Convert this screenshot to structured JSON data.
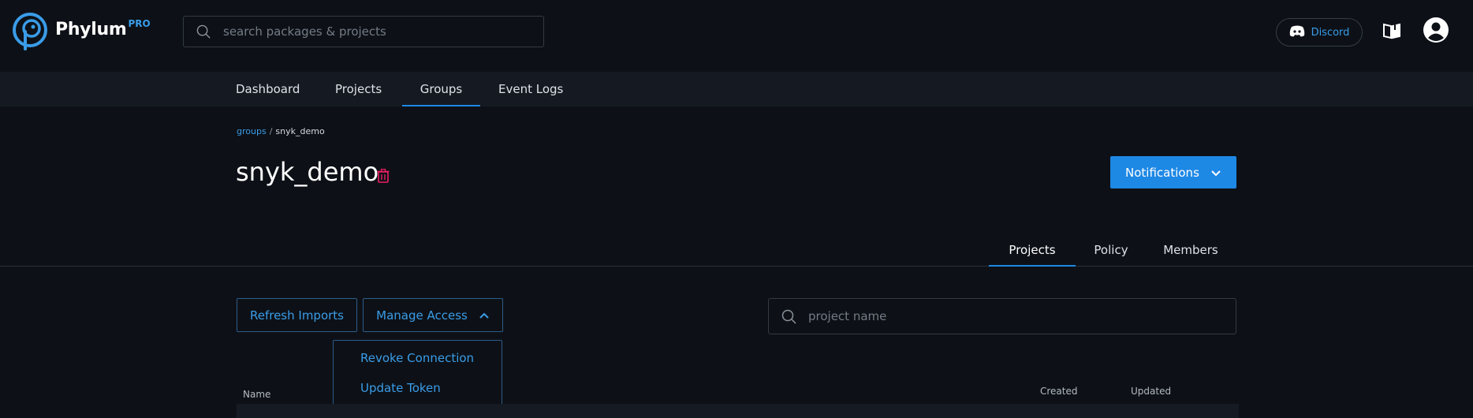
{
  "brand": {
    "name": "Phylum",
    "badge": "PRO"
  },
  "search": {
    "placeholder": "search packages & projects"
  },
  "header": {
    "discord_label": "Discord"
  },
  "nav": [
    {
      "label": "Dashboard"
    },
    {
      "label": "Projects"
    },
    {
      "label": "Groups",
      "active": true
    },
    {
      "label": "Event Logs"
    }
  ],
  "breadcrumb": {
    "parent": "groups",
    "separator": "/",
    "current": "snyk_demo"
  },
  "page": {
    "title": "snyk_demo",
    "notifications_label": "Notifications"
  },
  "tabs": [
    {
      "label": "Projects",
      "active": true
    },
    {
      "label": "Policy"
    },
    {
      "label": "Members"
    }
  ],
  "actions": {
    "refresh_label": "Refresh Imports",
    "manage_label": "Manage Access"
  },
  "manage_menu": [
    {
      "label": "Revoke Connection"
    },
    {
      "label": "Update Token"
    }
  ],
  "project_search": {
    "placeholder": "project name"
  },
  "table": {
    "columns": [
      "Name",
      "Created",
      "Updated"
    ]
  },
  "colors": {
    "accent": "#1e88e5",
    "link": "#3a9ce8",
    "danger": "#e91e63",
    "background": "#0d1117"
  },
  "icons": [
    "phylum-logo-icon",
    "search-icon",
    "discord-icon",
    "book-icon",
    "user-account-icon",
    "trash-icon",
    "chevron-down-icon",
    "chevron-up-icon"
  ]
}
